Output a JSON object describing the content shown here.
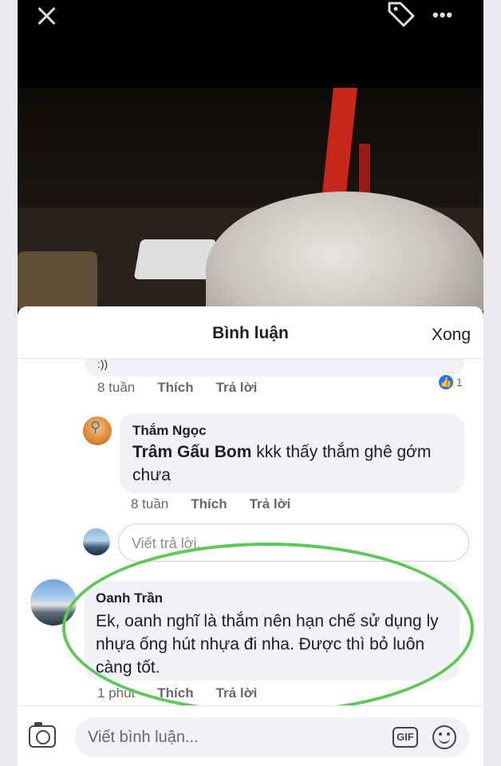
{
  "sheet": {
    "title": "Bình luận",
    "done_label": "Xong"
  },
  "comments": [
    {
      "text_partial": ":))",
      "time": "8 tuần",
      "like_label": "Thích",
      "reply_label": "Trả lời",
      "like_count": "1"
    },
    {
      "author": "Thắm Ngọc",
      "mention": "Trâm Gấu Bom",
      "text": " kkk thấy thắm ghê gớm chưa",
      "time": "8 tuần",
      "like_label": "Thích",
      "reply_label": "Trả lời"
    },
    {
      "author": "Oanh Trần",
      "text": "Ek, oanh nghĩ là thắm nên hạn chế sử dụng ly nhựa ống hút nhựa đi nha. Được thì bỏ luôn càng tốt.",
      "time": "1 phút",
      "like_label": "Thích",
      "reply_label": "Trả lời"
    }
  ],
  "reply_input": {
    "placeholder": "Viết trả lời..."
  },
  "comment_input": {
    "placeholder": "Viết bình luận...",
    "gif_label": "GIF"
  },
  "colors": {
    "highlight_ring": "#5cc957",
    "like_blue": "#1877f2"
  },
  "icons": [
    "close-icon",
    "tag-icon",
    "more-icon",
    "thumbs-up-icon",
    "camera-icon",
    "gif-icon",
    "emoji-icon"
  ]
}
